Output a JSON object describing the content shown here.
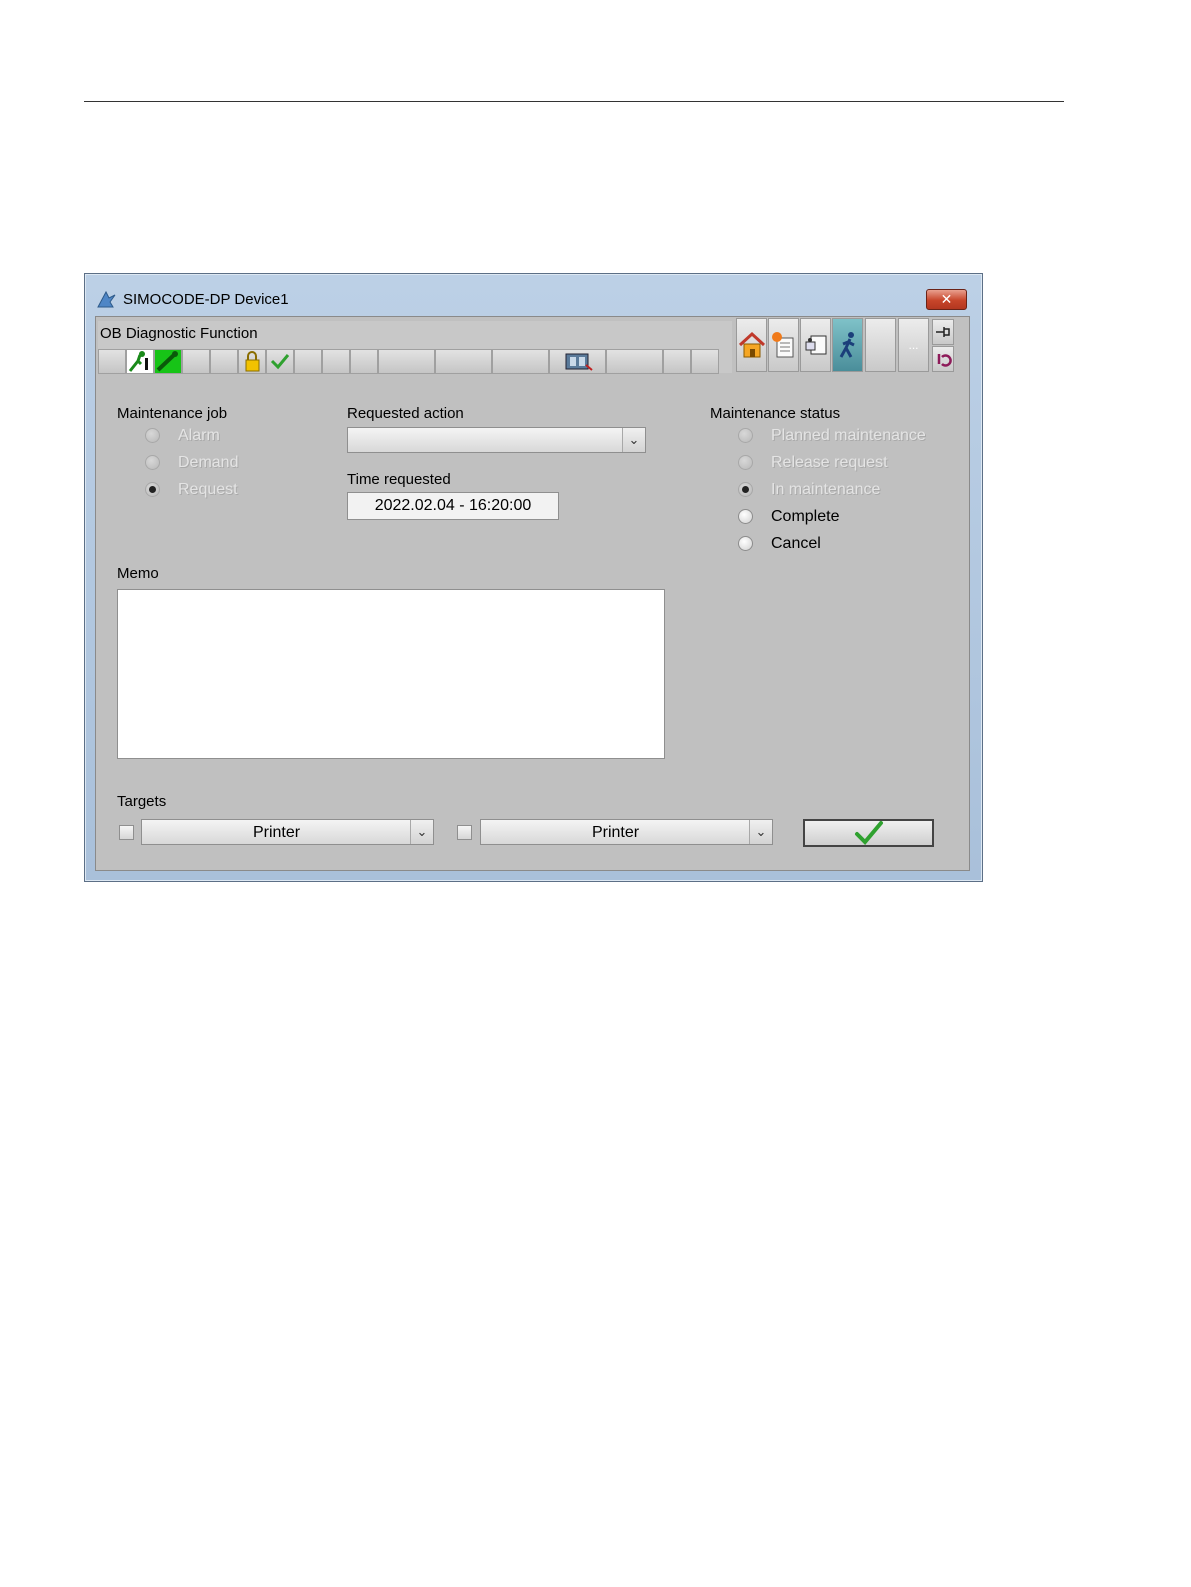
{
  "window": {
    "title": "SIMOCODE-DP Device1",
    "close_symbol": "✕"
  },
  "toolbar": {
    "function_name": "OB Diagnostic Function",
    "more_symbol": "...",
    "icons": [
      "person-wrench-icon",
      "wrench-green-icon",
      "lock-icon",
      "check-icon",
      "device-icon",
      "home-icon",
      "document-star-icon",
      "faceplate-icon",
      "walking-figure-icon",
      "pin-icon",
      "return-icon"
    ]
  },
  "maintenance_job": {
    "label": "Maintenance job",
    "options": [
      {
        "label": "Alarm",
        "selected": false,
        "enabled": false
      },
      {
        "label": "Demand",
        "selected": false,
        "enabled": false
      },
      {
        "label": "Request",
        "selected": true,
        "enabled": false
      }
    ]
  },
  "requested_action": {
    "label": "Requested action",
    "value": ""
  },
  "time_requested": {
    "label": "Time requested",
    "value": "2022.02.04 - 16:20:00"
  },
  "maintenance_status": {
    "label": "Maintenance status",
    "options": [
      {
        "label": "Planned maintenance",
        "selected": false,
        "enabled": false
      },
      {
        "label": "Release request",
        "selected": false,
        "enabled": false
      },
      {
        "label": "In maintenance",
        "selected": true,
        "enabled": false
      },
      {
        "label": "Complete",
        "selected": false,
        "enabled": true
      },
      {
        "label": "Cancel",
        "selected": false,
        "enabled": true
      }
    ]
  },
  "memo": {
    "label": "Memo",
    "value": ""
  },
  "targets": {
    "label": "Targets",
    "target1": {
      "checked": false,
      "value": "Printer"
    },
    "target2": {
      "checked": false,
      "value": "Printer"
    }
  },
  "colors": {
    "window_frame": "#bcd0e6",
    "client_bg": "#c0c0c0",
    "close_red": "#c7452a",
    "ok_green": "#2fa12f"
  }
}
